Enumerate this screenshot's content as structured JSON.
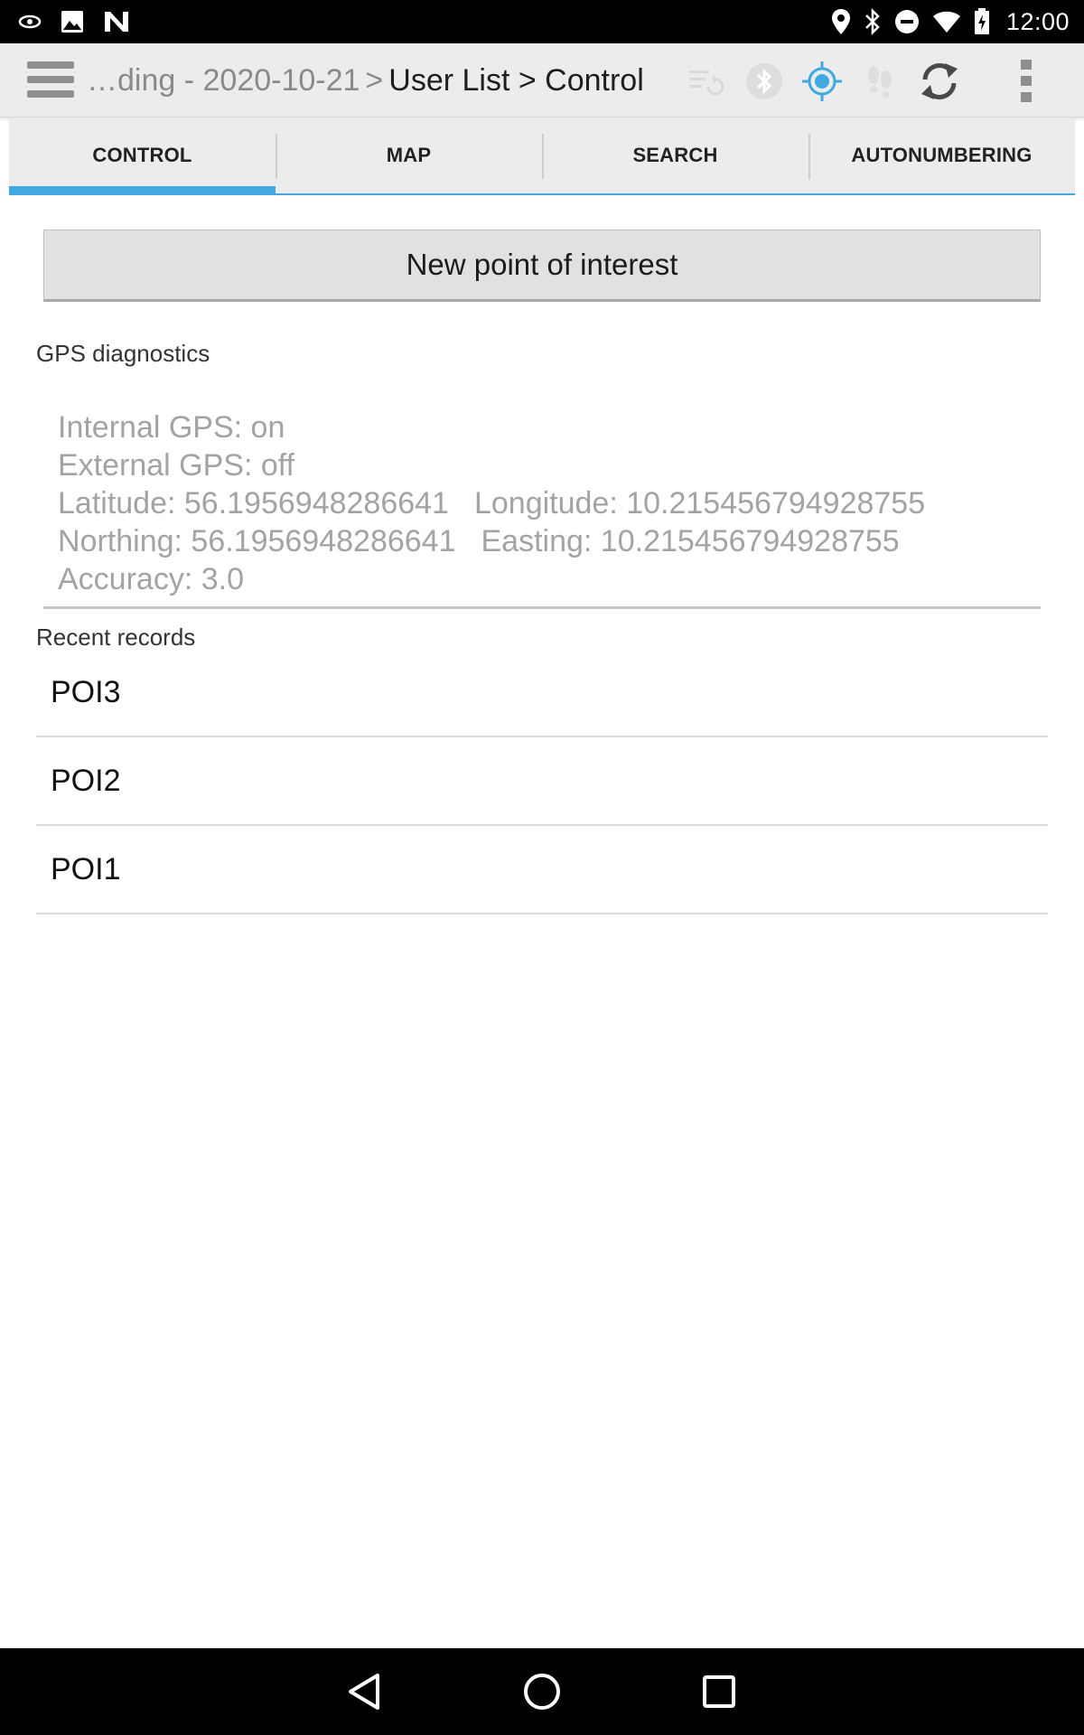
{
  "status_bar": {
    "time": "12:00",
    "left_icons": [
      "vision-icon",
      "image-icon",
      "n-logo-icon"
    ],
    "right_icons": [
      "location-pin-icon",
      "bluetooth-icon",
      "do-not-disturb-icon",
      "wifi-icon",
      "battery-icon"
    ]
  },
  "action_bar": {
    "breadcrumb": {
      "dim_part": "…ding - 2020-10-21",
      "separator": ">",
      "current": "User List > Control"
    },
    "icons": [
      "sync-list-icon",
      "bluetooth-icon",
      "gps-target-icon",
      "footsteps-icon",
      "refresh-icon",
      "overflow-menu-icon"
    ],
    "accent_color": "#3fa9e0"
  },
  "tabs": [
    {
      "label": "CONTROL",
      "active": true
    },
    {
      "label": "MAP",
      "active": false
    },
    {
      "label": "SEARCH",
      "active": false
    },
    {
      "label": "AUTONUMBERING",
      "active": false
    }
  ],
  "main": {
    "new_poi_button": "New point of interest",
    "gps_section_label": "GPS diagnostics",
    "gps": {
      "internal": "Internal GPS: on",
      "external": "External GPS: off",
      "latitude": "Latitude: 56.1956948286641",
      "longitude": "Longitude: 10.215456794928755",
      "northing": "Northing: 56.1956948286641",
      "easting": "Easting: 10.215456794928755",
      "accuracy": "Accuracy: 3.0"
    },
    "recent_label": "Recent records",
    "recent_records": [
      "POI3",
      "POI2",
      "POI1"
    ]
  },
  "nav_bar": {
    "icons": [
      "back-icon",
      "home-icon",
      "recents-icon"
    ]
  }
}
